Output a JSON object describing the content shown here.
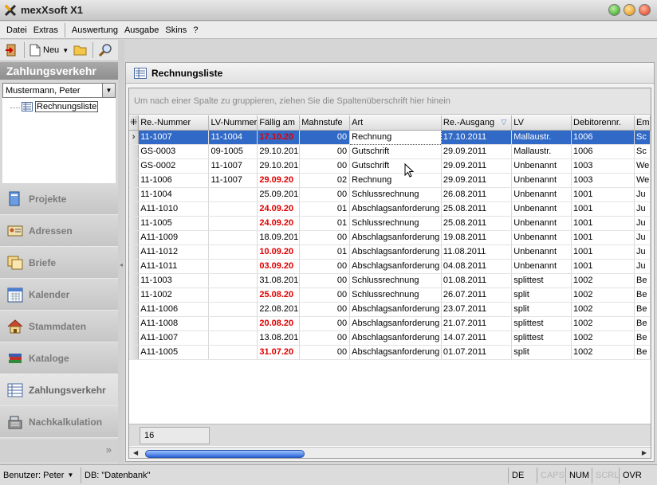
{
  "window": {
    "title": "mexXsoft X1"
  },
  "menu": [
    "Datei",
    "Extras",
    "Auswertung",
    "Ausgabe",
    "Skins",
    "?"
  ],
  "toolbar": {
    "new_label": "Neu"
  },
  "sidebar": {
    "header": "Zahlungsverkehr",
    "user_select": "Mustermann, Peter",
    "tree_item": "Rechnungsliste",
    "nav": [
      {
        "label": "Projekte",
        "icon": "projects-icon"
      },
      {
        "label": "Adressen",
        "icon": "addresses-icon"
      },
      {
        "label": "Briefe",
        "icon": "letters-icon"
      },
      {
        "label": "Kalender",
        "icon": "calendar-icon"
      },
      {
        "label": "Stammdaten",
        "icon": "house-icon"
      },
      {
        "label": "Kataloge",
        "icon": "books-icon"
      },
      {
        "label": "Zahlungsverkehr",
        "icon": "payments-icon"
      },
      {
        "label": "Nachkalkulation",
        "icon": "cash-register-icon"
      }
    ],
    "more": "»"
  },
  "main": {
    "title": "Rechnungsliste",
    "group_hint": "Um nach einer Spalte zu gruppieren, ziehen Sie die Spaltenüberschrift hier hinein",
    "columns": [
      "Re.-Nummer",
      "LV-Nummer",
      "Fällig am",
      "Mahnstufe",
      "Art",
      "Re.-Ausgang",
      "LV",
      "Debitorennr.",
      "Em"
    ],
    "rows": [
      [
        "11-1007",
        "11-1004",
        "17.10.20",
        "00",
        "Rechnung",
        "17.10.2011",
        "Mallaustr.",
        "1006",
        "Sc"
      ],
      [
        "GS-0003",
        "09-1005",
        "29.10.201",
        "00",
        "Gutschrift",
        "29.09.2011",
        "Mallaustr.",
        "1006",
        "Sc"
      ],
      [
        "GS-0002",
        "11-1007",
        "29.10.201",
        "00",
        "Gutschrift",
        "29.09.2011",
        "Unbenannt",
        "1003",
        "We"
      ],
      [
        "11-1006",
        "11-1007",
        "29.09.20",
        "02",
        "Rechnung",
        "29.09.2011",
        "Unbenannt",
        "1003",
        "We"
      ],
      [
        "11-1004",
        "",
        "25.09.201",
        "00",
        "Schlussrechnung",
        "26.08.2011",
        "Unbenannt",
        "1001",
        "Ju"
      ],
      [
        "A11-1010",
        "",
        "24.09.20",
        "01",
        "Abschlagsanforderung",
        "25.08.2011",
        "Unbenannt",
        "1001",
        "Ju"
      ],
      [
        "11-1005",
        "",
        "24.09.20",
        "01",
        "Schlussrechnung",
        "25.08.2011",
        "Unbenannt",
        "1001",
        "Ju"
      ],
      [
        "A11-1009",
        "",
        "18.09.201",
        "00",
        "Abschlagsanforderung",
        "19.08.2011",
        "Unbenannt",
        "1001",
        "Ju"
      ],
      [
        "A11-1012",
        "",
        "10.09.20",
        "01",
        "Abschlagsanforderung",
        "11.08.2011",
        "Unbenannt",
        "1001",
        "Ju"
      ],
      [
        "A11-1011",
        "",
        "03.09.20",
        "00",
        "Abschlagsanforderung",
        "04.08.2011",
        "Unbenannt",
        "1001",
        "Ju"
      ],
      [
        "11-1003",
        "",
        "31.08.201",
        "00",
        "Schlussrechnung",
        "01.08.2011",
        "splittest",
        "1002",
        "Be"
      ],
      [
        "11-1002",
        "",
        "25.08.20",
        "00",
        "Schlussrechnung",
        "26.07.2011",
        "split",
        "1002",
        "Be"
      ],
      [
        "A11-1006",
        "",
        "22.08.201",
        "00",
        "Abschlagsanforderung",
        "23.07.2011",
        "split",
        "1002",
        "Be"
      ],
      [
        "A11-1008",
        "",
        "20.08.20",
        "00",
        "Abschlagsanforderung",
        "21.07.2011",
        "splittest",
        "1002",
        "Be"
      ],
      [
        "A11-1007",
        "",
        "13.08.201",
        "00",
        "Abschlagsanforderung",
        "14.07.2011",
        "splittest",
        "1002",
        "Be"
      ],
      [
        "A11-1005",
        "",
        "31.07.20",
        "00",
        "Abschlagsanforderung",
        "01.07.2011",
        "split",
        "1002",
        "Be"
      ]
    ],
    "overdue_rows": [
      0,
      3,
      5,
      6,
      8,
      9,
      11,
      13,
      15
    ],
    "selected_row": 0,
    "count": "16"
  },
  "statusbar": {
    "user": "Benutzer: Peter",
    "db": "DB: \"Datenbank\"",
    "lang": "DE",
    "caps": "CAPS",
    "num": "NUM",
    "scrl": "SCRL",
    "ovr": "OVR"
  },
  "colors": {
    "selection": "#3169c6",
    "overdue": "#e00000",
    "accent_scroll": "#2a63d8"
  }
}
